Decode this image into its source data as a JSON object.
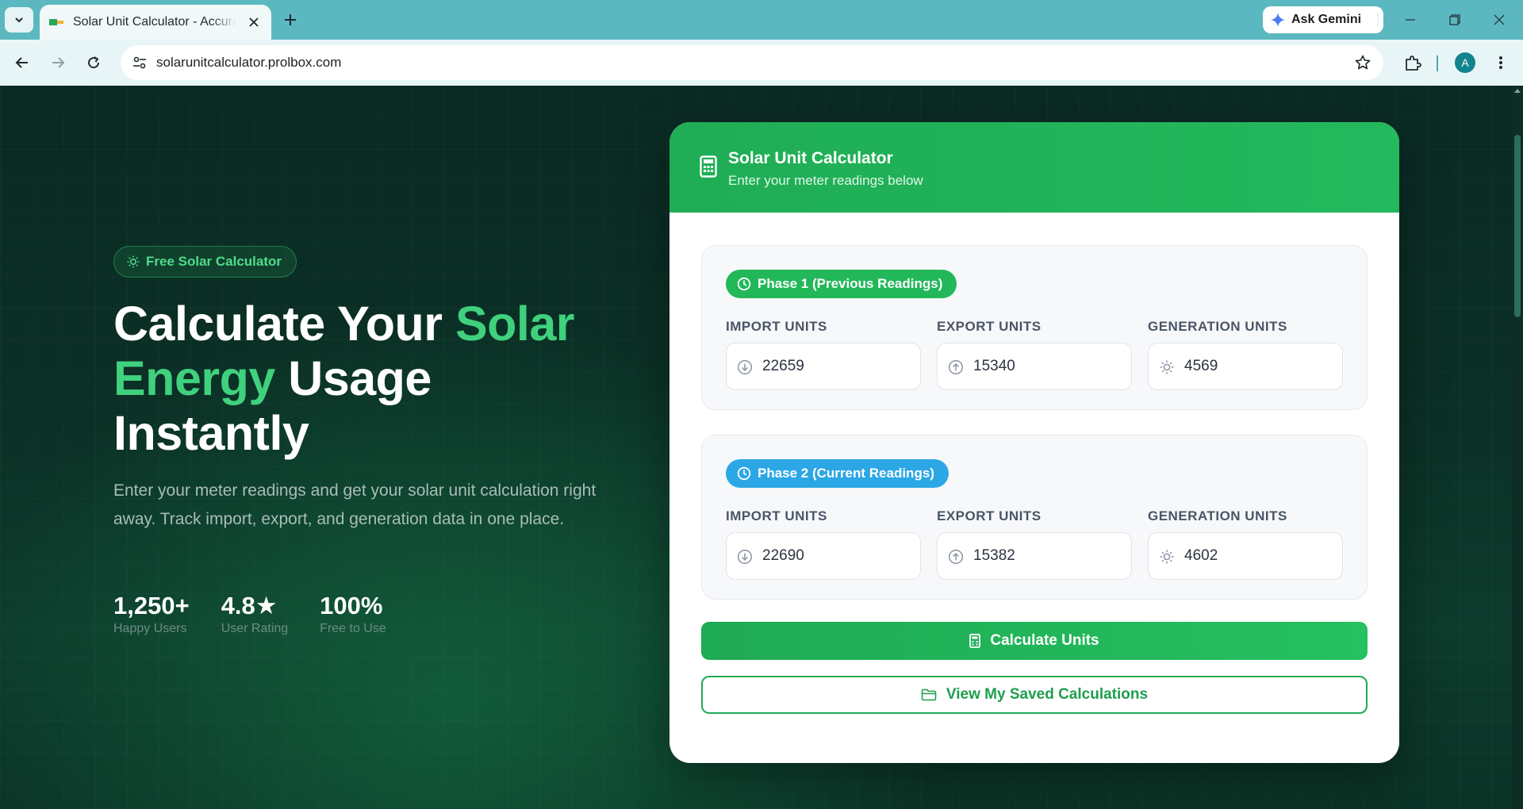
{
  "browser": {
    "tab_title": "Solar Unit Calculator - Accurate Solar Unit Calculation",
    "url": "solarunitcalculator.prolbox.com",
    "gemini_label": "Ask Gemini",
    "profile_initial": "A"
  },
  "hero": {
    "badge": "Free Solar Calculator",
    "title_part1": "Calculate Your ",
    "title_accent": "Solar Energy",
    "title_part2": " Usage Instantly",
    "subtitle": "Enter your meter readings and get your solar unit calculation right away. Track import, export, and generation data in one place.",
    "stats": [
      {
        "value": "1,250+",
        "label": "Happy Users"
      },
      {
        "value": "4.8★",
        "label": "User Rating"
      },
      {
        "value": "100%",
        "label": "Free to Use"
      }
    ]
  },
  "calculator": {
    "title": "Solar Unit Calculator",
    "subtitle": "Enter your meter readings below",
    "phase1": {
      "label": "Phase 1 (Previous Readings)",
      "import_label": "IMPORT UNITS",
      "import_value": "22659",
      "export_label": "EXPORT UNITS",
      "export_value": "15340",
      "generation_label": "GENERATION UNITS",
      "generation_value": "4569"
    },
    "phase2": {
      "label": "Phase 2 (Current Readings)",
      "import_label": "IMPORT UNITS",
      "import_value": "22690",
      "export_label": "EXPORT UNITS",
      "export_value": "15382",
      "generation_label": "GENERATION UNITS",
      "generation_value": "4602"
    },
    "calculate_label": "Calculate Units",
    "saved_label": "View My Saved Calculations"
  },
  "icons": {
    "tab_list": "chevron-down-icon",
    "close": "close-icon",
    "new_tab": "plus-icon",
    "back": "arrow-left-icon",
    "forward": "arrow-right-icon",
    "reload": "reload-icon",
    "site_info": "tune-icon",
    "bookmark": "star-icon",
    "extensions": "puzzle-icon",
    "menu": "kebab-menu-icon",
    "calculator": "calculator-icon",
    "clock": "clock-icon",
    "import": "arrow-down-circle-icon",
    "export": "arrow-up-circle-icon",
    "generation": "sun-icon",
    "folder": "folder-icon"
  },
  "colors": {
    "accent_green": "#3fd17d",
    "brand_green": "#22b85a",
    "phase2_blue": "#2ba7e6",
    "browser_frame": "#5cb8c0"
  }
}
